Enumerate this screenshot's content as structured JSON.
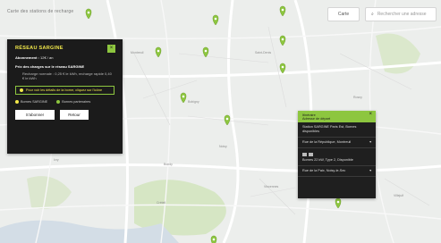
{
  "breadcrumb": "Carte des stations de recharge",
  "map": {
    "type_button": "Carte",
    "search_placeholder": "Rechercher une adresse",
    "pins": [
      {
        "id": "p1"
      },
      {
        "id": "p2"
      },
      {
        "id": "p3"
      },
      {
        "id": "p4"
      },
      {
        "id": "p5"
      },
      {
        "id": "p6"
      },
      {
        "id": "p7"
      },
      {
        "id": "p8"
      },
      {
        "id": "p9"
      },
      {
        "id": "p10"
      },
      {
        "id": "p11"
      }
    ],
    "towns": [
      "Montreuil",
      "Saint-Denis",
      "Bobigny",
      "Rosny",
      "Noisy",
      "Bondy",
      "Vincennes",
      "Créteil",
      "Ivry",
      "Villejuif"
    ]
  },
  "info_panel": {
    "title": "RÉSEAU SARGINE",
    "close": "×",
    "row1_label": "Abonnement :",
    "row1_value": "12€ / an",
    "row2_label": "Prix des charges sur le réseau SARGINE",
    "sub_line": "Recharge normale : 0,25 € le kWh, recharge rapide 0,40 € le kWh",
    "hint": "Pour voir les détails de la borne, cliquez sur l'icône",
    "legend": [
      "Bornes SARGINE",
      "Bornes partenaires"
    ],
    "btn_primary": "S'abonner",
    "btn_secondary": "Retour"
  },
  "route_panel": {
    "header_line1": "Itinéraire",
    "header_line2": "Adresse de départ",
    "close": "×",
    "items": [
      {
        "text": "Station SARGINE Paris Est, Bornes disponibles",
        "chev": ""
      },
      {
        "text": "Rue de la République, Montreuil",
        "chev": "▾"
      },
      {
        "text": "Bornes 22 kW, Type 2, Disponible",
        "chev": ""
      },
      {
        "text": "Rue de la Paix, Noisy-le-Sec",
        "chev": "▾"
      }
    ]
  },
  "colors": {
    "accent": "#8dc63f",
    "highlight": "#f2e84a",
    "panel_bg": "#1b1b1b",
    "map_bg": "#eceeec"
  }
}
